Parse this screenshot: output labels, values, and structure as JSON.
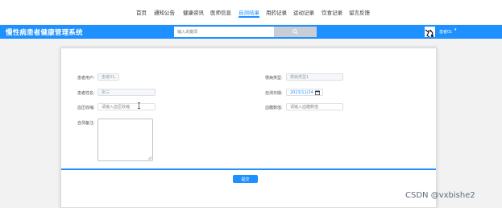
{
  "nav": {
    "items": [
      "首页",
      "通知公告",
      "健康资讯",
      "医师信息",
      "自测结果",
      "用药记录",
      "运动记录",
      "饮食记录",
      "留言反馈"
    ],
    "active_index": 4
  },
  "header": {
    "brand": "慢性病患者健康管理系统",
    "search_placeholder": "输入关键词",
    "search_icon": "search-icon",
    "user_name": "患者01",
    "caret": "▾"
  },
  "form": {
    "account_label": "患者用户:",
    "account_value": "患者01",
    "disease_label": "慢病类型:",
    "disease_value": "慢病类型1",
    "name_label": "患者姓名:",
    "name_value": "张三",
    "date_label": "自测日期:",
    "date_value": "2023/11/24",
    "glucose_label": "血压收缩:",
    "glucose_placeholder": "请输入血压收缩",
    "pressure_label": "血糖数值:",
    "pressure_placeholder": "请输入血糖数值",
    "notes_label": "自测备注:",
    "submit_label": "提交"
  },
  "watermark": "CSDN @vxbishe2",
  "colors": {
    "accent": "#1e90ff",
    "page_bg": "#f2f2f2"
  }
}
